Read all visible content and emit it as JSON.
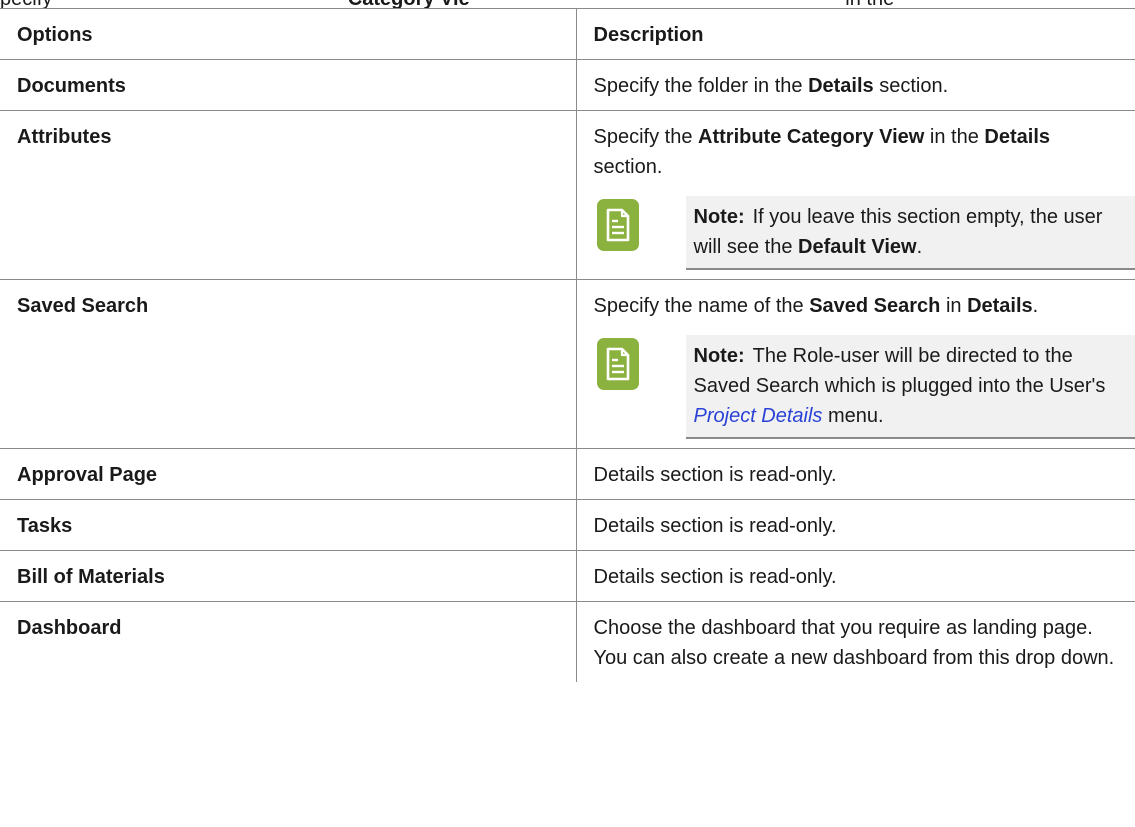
{
  "intro": {
    "prefix": "pecify",
    "bold": "Category Vie",
    "suffix": "in the"
  },
  "table": {
    "headers": [
      "Options",
      "Description"
    ],
    "rows": [
      {
        "option": "Documents",
        "desc": [
          "Specify the folder in the ",
          "Details",
          " section."
        ]
      },
      {
        "option": "Attributes",
        "desc": [
          "Specify the ",
          "Attribute Category View",
          " in the ",
          "Details",
          " section."
        ],
        "note": {
          "label": "Note:",
          "parts": [
            "If you leave this section empty, the user will see the ",
            "Default View",
            "."
          ]
        }
      },
      {
        "option": "Saved Search",
        "desc": [
          "Specify the name of the ",
          "Saved Search",
          " in ",
          "Details",
          "."
        ],
        "note": {
          "label": "Note:",
          "parts": [
            "The Role-user will be directed to the Saved Search which is plugged into the User's ",
            "Project Details",
            " menu."
          ]
        }
      },
      {
        "option": "Approval Page",
        "desc": [
          "Details section is read-only."
        ]
      },
      {
        "option": "Tasks",
        "desc": [
          "Details section is read-only."
        ]
      },
      {
        "option": "Bill of Materials",
        "desc": [
          "Details section is read-only."
        ]
      },
      {
        "option": "Dashboard",
        "desc": [
          "Choose the dashboard that you require as landing page. You can also create a new dashboard from this drop down."
        ]
      }
    ]
  },
  "colors": {
    "note_icon": "#8bb23f",
    "note_bg": "#f1f1f1",
    "link": "#2a41d6",
    "border": "#8a8a8a"
  },
  "icons": {
    "note": "note-document-icon"
  }
}
